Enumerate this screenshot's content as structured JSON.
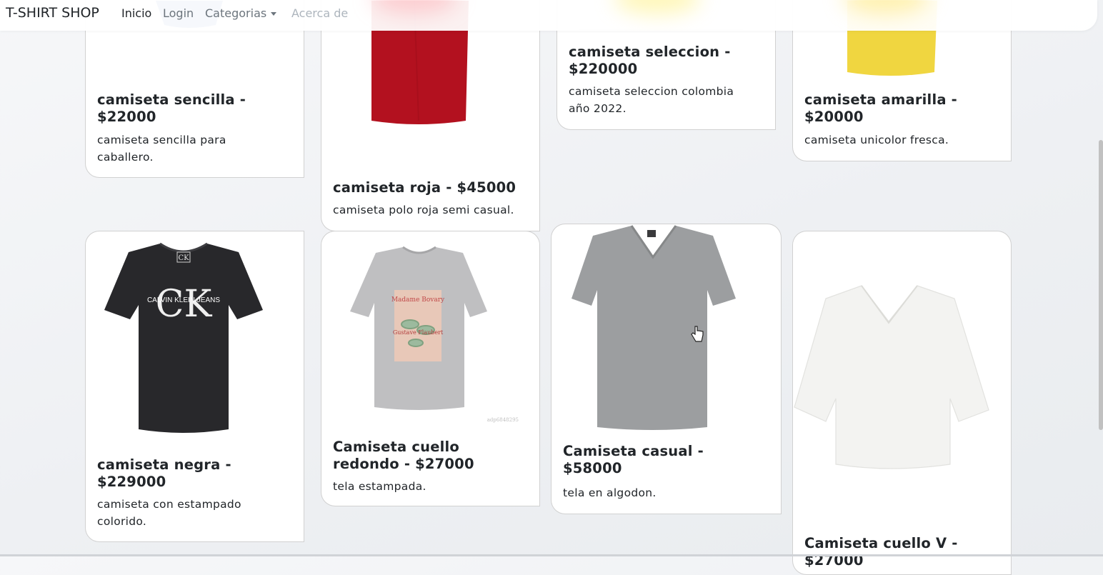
{
  "navbar": {
    "brand": "T-SHIRT SHOP",
    "links": [
      {
        "label": "Inicio"
      },
      {
        "label": "Login"
      },
      {
        "label": "Categorias"
      },
      {
        "label": "Acerca de"
      }
    ]
  },
  "products": [
    {
      "title": "camiseta sencilla - $22000",
      "description": "camiseta sencilla para caballero.",
      "image": "blue-tshirt"
    },
    {
      "title": "camiseta roja - $45000",
      "description": "camiseta polo roja semi casual.",
      "image": "red-tshirt"
    },
    {
      "title": "camiseta seleccion - $220000",
      "description": "camiseta seleccion colombia año 2022.",
      "image": "jersey"
    },
    {
      "title": "camiseta amarilla - $20000",
      "description": "camiseta unicolor fresca.",
      "image": "yellow-tshirt"
    },
    {
      "title": "camiseta negra - $229000",
      "description": "camiseta con estampado colorido.",
      "image": "black-tshirt",
      "print": "CALVIN KLEIN JEANS",
      "logo": "CK"
    },
    {
      "title": "Camiseta cuello redondo - $27000",
      "description": "tela estampada.",
      "image": "grey-printed-tshirt",
      "print_top": "Madame Bovary",
      "print_mid": "Gustave Flaubert",
      "watermark": "adp6848295"
    },
    {
      "title": "Camiseta casual - $58000",
      "description": "tela en algodon.",
      "image": "grey-vneck-tshirt"
    },
    {
      "title": "Camiseta cuello V - $27000",
      "description": "",
      "image": "white-vneck-tshirt"
    }
  ],
  "cursor": "hand-pointer-icon"
}
